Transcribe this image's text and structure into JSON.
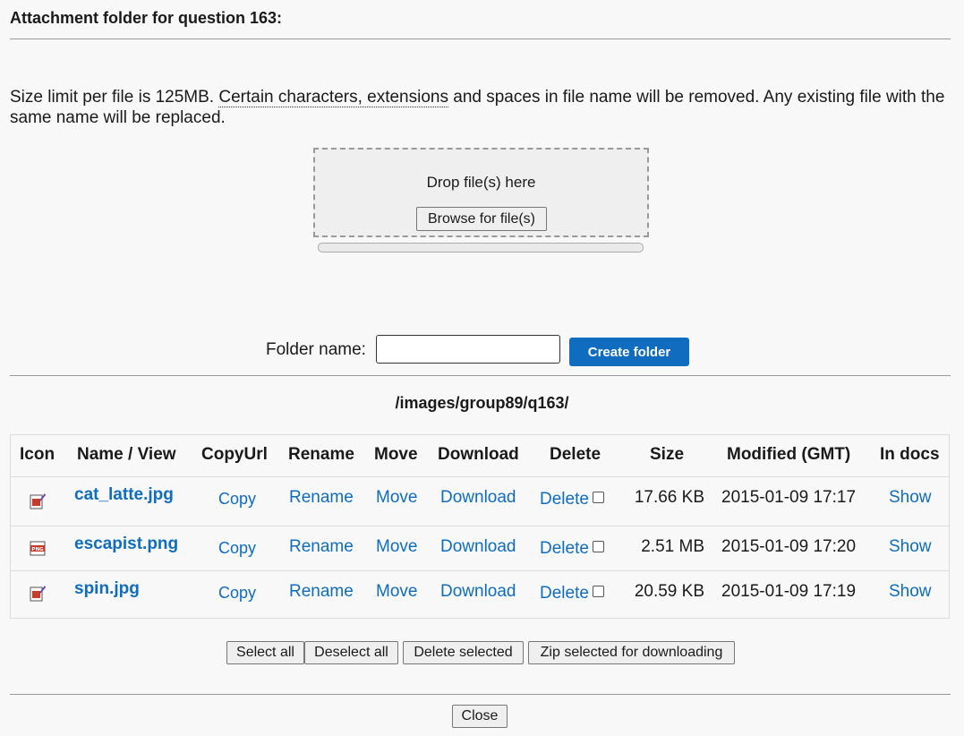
{
  "header": {
    "title": "Attachment folder for question 163:"
  },
  "intro": {
    "part1": "Size limit per file is 125MB. ",
    "link": "Certain characters, extensions",
    "part2": " and spaces in file name will be removed. Any existing file with the same name will be replaced."
  },
  "upload": {
    "drop_text": "Drop file(s) here",
    "browse_label": "Browse for file(s)"
  },
  "folder": {
    "label": "Folder name:",
    "value": "",
    "create_label": "Create folder"
  },
  "path": "/images/group89/q163/",
  "table": {
    "headers": [
      "Icon",
      "Name / View",
      "CopyUrl",
      "Rename",
      "Move",
      "Download",
      "Delete",
      "Size",
      "Modified (GMT)",
      "In docs"
    ],
    "rows": [
      {
        "icon": "image-file-icon",
        "name": "cat_latte.jpg",
        "copy": "Copy",
        "rename": "Rename",
        "move": "Move",
        "download": "Download",
        "delete": "Delete",
        "size": "17.66 KB",
        "modified": "2015-01-09 17:17",
        "docs": "Show"
      },
      {
        "icon": "png-file-icon",
        "name": "escapist.png",
        "copy": "Copy",
        "rename": "Rename",
        "move": "Move",
        "download": "Download",
        "delete": "Delete",
        "size": "2.51 MB",
        "modified": "2015-01-09 17:20",
        "docs": "Show"
      },
      {
        "icon": "image-file-icon",
        "name": "spin.jpg",
        "copy": "Copy",
        "rename": "Rename",
        "move": "Move",
        "download": "Download",
        "delete": "Delete",
        "size": "20.59 KB",
        "modified": "2015-01-09 17:19",
        "docs": "Show"
      }
    ]
  },
  "actions": {
    "select_all": "Select all",
    "deselect_all": "Deselect all",
    "delete_selected": "Delete selected",
    "zip_selected": "Zip selected for downloading"
  },
  "footer": {
    "close_label": "Close"
  },
  "colors": {
    "link": "#0f6cbf",
    "primary_button": "#0f6cbf",
    "background": "#f8f8f8"
  }
}
